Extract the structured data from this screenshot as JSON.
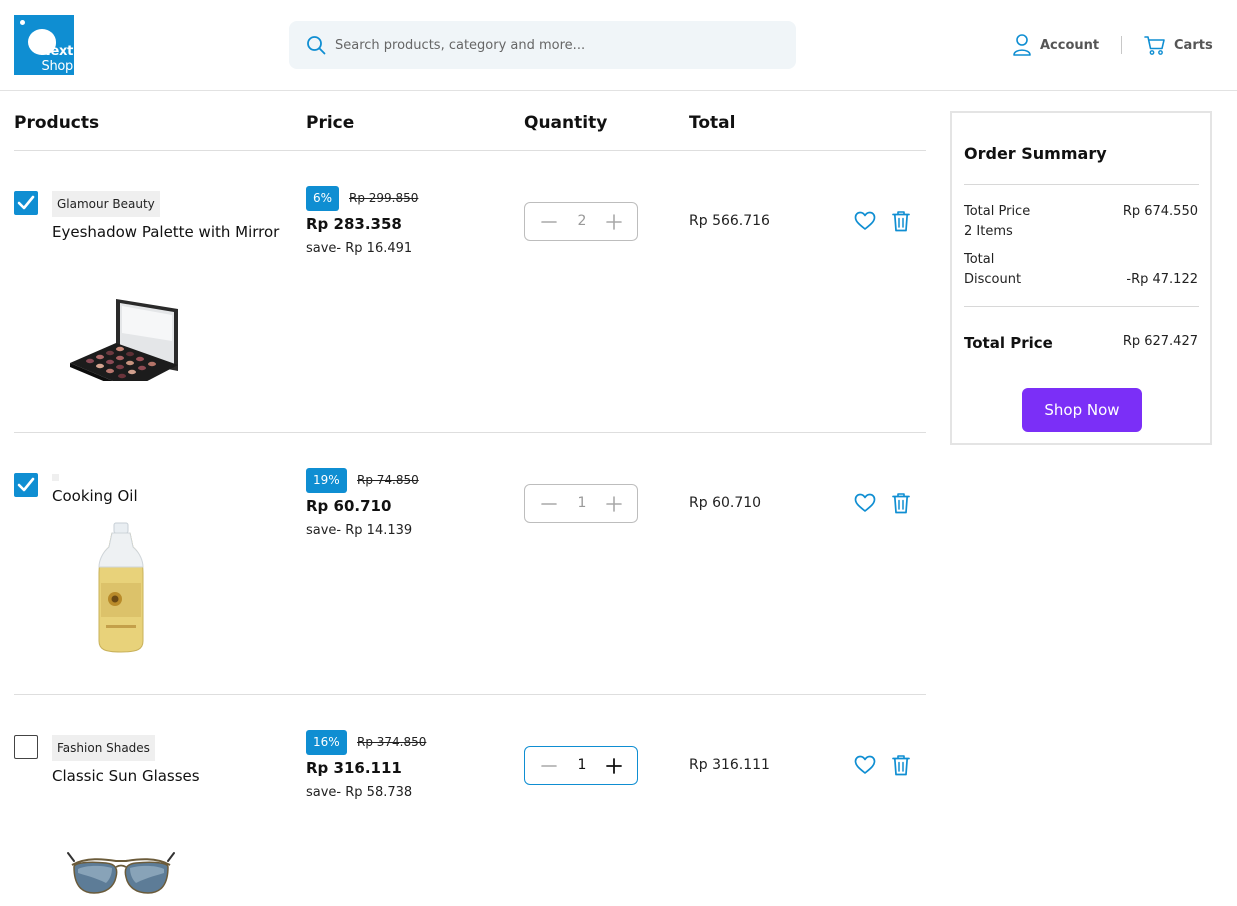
{
  "header": {
    "logo": {
      "line1": "Next",
      "line2": "Shop"
    },
    "search": {
      "placeholder": "Search products, category and more...",
      "value": ""
    },
    "account_label": "Account",
    "carts_label": "Carts"
  },
  "table": {
    "col_products": "Products",
    "col_price": "Price",
    "col_quantity": "Quantity",
    "col_total": "Total"
  },
  "items": [
    {
      "checked": true,
      "brand": "Glamour Beauty",
      "name": "Eyeshadow Palette with Mirror",
      "image": "eyeshadow-palette",
      "discount": "6%",
      "old_price": "Rp 299.850",
      "price": "Rp 283.358",
      "save": "save- Rp 16.491",
      "quantity": "2",
      "total": "Rp 566.716"
    },
    {
      "checked": true,
      "brand": "",
      "name": "Cooking Oil",
      "image": "cooking-oil-bottle",
      "discount": "19%",
      "old_price": "Rp 74.850",
      "price": "Rp 60.710",
      "save": "save- Rp 14.139",
      "quantity": "1",
      "total": "Rp 60.710"
    },
    {
      "checked": false,
      "brand": "Fashion Shades",
      "name": "Classic Sun Glasses",
      "image": "aviator-sunglasses",
      "discount": "16%",
      "old_price": "Rp 374.850",
      "price": "Rp 316.111",
      "save": "save- Rp 58.738",
      "quantity": "1",
      "total": "Rp 316.111"
    }
  ],
  "summary": {
    "title": "Order Summary",
    "total_price_label": "Total Price",
    "items_count": "2 Items",
    "total_price_value": "Rp 674.550",
    "discount_label_1": "Total",
    "discount_label_2": "Discount",
    "discount_value": "-Rp 47.122",
    "grand_total_label": "Total Price",
    "grand_total_value": "Rp 627.427",
    "button_label": "Shop Now"
  },
  "colors": {
    "accent": "#0f8ed2",
    "button": "#7b2ff7"
  },
  "icons": [
    "search-icon",
    "user-icon",
    "cart-icon",
    "check-icon",
    "minus-icon",
    "plus-icon",
    "heart-icon",
    "trash-icon"
  ]
}
